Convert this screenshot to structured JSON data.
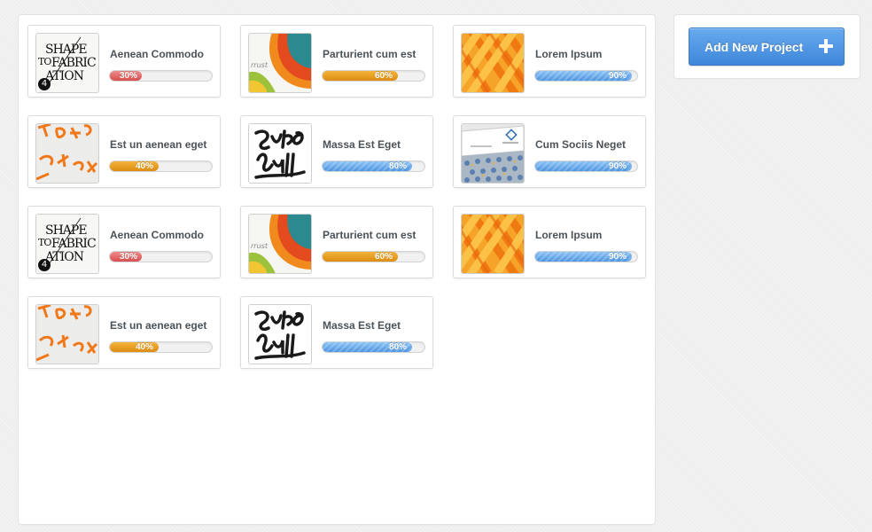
{
  "sidebar": {
    "add_project_label": "Add New Project"
  },
  "projects": [
    {
      "title": "Aenean Commodo",
      "progress": 0.3,
      "progress_label": "30%",
      "color": "red",
      "thumb": "shape-to-fabrication",
      "badge": "4"
    },
    {
      "title": "Parturient cum est",
      "progress": 0.6,
      "progress_label": "60%",
      "color": "orange",
      "thumb": "trust-waves",
      "thumb_text": "rrust"
    },
    {
      "title": "Lorem Ipsum",
      "progress": 0.9,
      "progress_label": "90%",
      "color": "blue",
      "thumb": "orange-lattice"
    },
    {
      "title": "Est un aenean eget",
      "progress": 0.4,
      "progress_label": "40%",
      "color": "orange",
      "thumb": "orange-type"
    },
    {
      "title": "Massa Est Eget",
      "progress": 0.8,
      "progress_label": "80%",
      "color": "blue",
      "thumb": "script-lettering"
    },
    {
      "title": "Cum Sociis Neget",
      "progress": 0.9,
      "progress_label": "90%",
      "color": "blue",
      "thumb": "business-cards"
    },
    {
      "title": "Aenean Commodo",
      "progress": 0.3,
      "progress_label": "30%",
      "color": "red",
      "thumb": "shape-to-fabrication",
      "badge": "4"
    },
    {
      "title": "Parturient cum est",
      "progress": 0.6,
      "progress_label": "60%",
      "color": "orange",
      "thumb": "trust-waves",
      "thumb_text": "rrust"
    },
    {
      "title": "Lorem Ipsum",
      "progress": 0.9,
      "progress_label": "90%",
      "color": "blue",
      "thumb": "orange-lattice"
    },
    {
      "title": "Est un aenean eget",
      "progress": 0.4,
      "progress_label": "40%",
      "color": "orange",
      "thumb": "orange-type"
    },
    {
      "title": "Massa Est Eget",
      "progress": 0.8,
      "progress_label": "80%",
      "color": "blue",
      "thumb": "script-lettering"
    }
  ]
}
